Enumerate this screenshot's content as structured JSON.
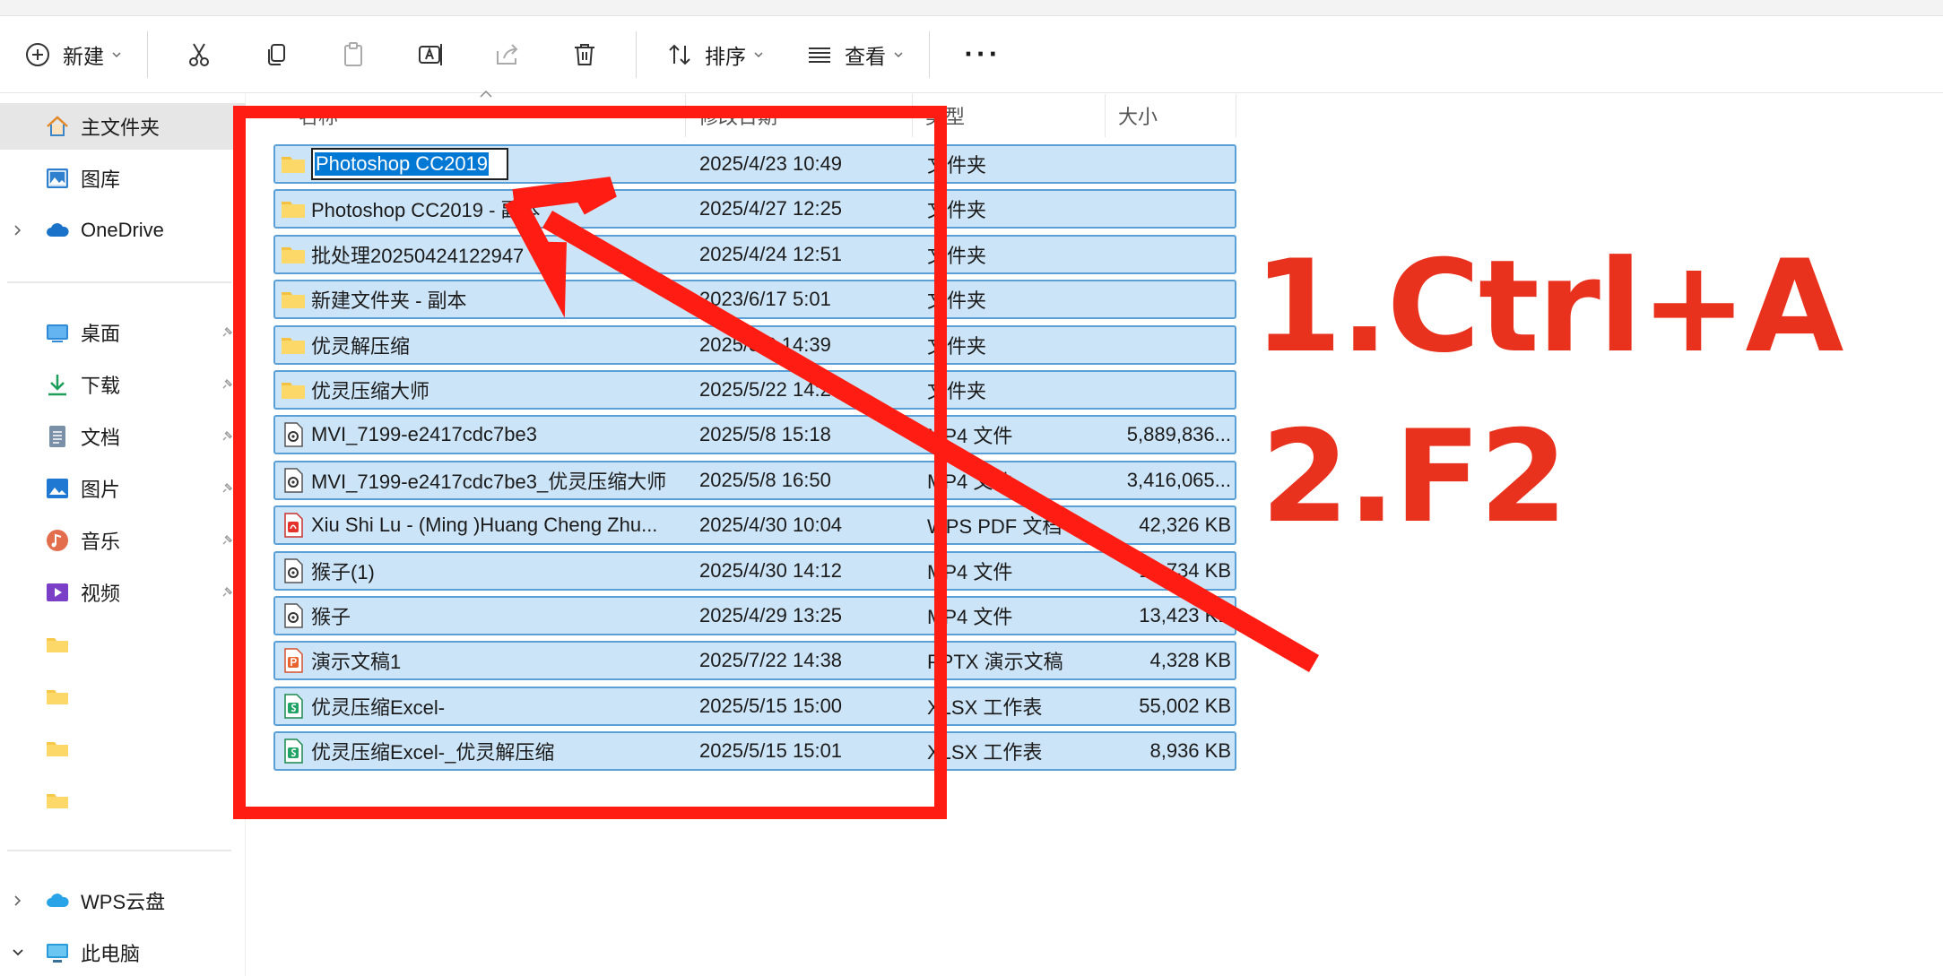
{
  "toolbar": {
    "new_label": "新建",
    "sort_label": "排序",
    "view_label": "查看",
    "more_label": "···"
  },
  "sidebar": {
    "items": [
      {
        "label": "主文件夹",
        "icon": "home-icon"
      },
      {
        "label": "图库",
        "icon": "gallery-icon"
      },
      {
        "label": "OneDrive",
        "icon": "cloud-icon"
      },
      {
        "label": "桌面",
        "icon": "desktop-icon"
      },
      {
        "label": "下载",
        "icon": "download-icon"
      },
      {
        "label": "文档",
        "icon": "document-icon"
      },
      {
        "label": "图片",
        "icon": "pictures-icon"
      },
      {
        "label": "音乐",
        "icon": "music-icon"
      },
      {
        "label": "视频",
        "icon": "video-icon"
      },
      {
        "label": "",
        "icon": "folder-icon"
      },
      {
        "label": "",
        "icon": "folder-icon"
      },
      {
        "label": "",
        "icon": "folder-icon"
      },
      {
        "label": "",
        "icon": "folder-icon"
      },
      {
        "label": "WPS云盘",
        "icon": "cloud-icon"
      },
      {
        "label": "此电脑",
        "icon": "computer-icon"
      }
    ]
  },
  "columns": {
    "name": "名称",
    "date": "修改日期",
    "type": "类型",
    "size": "大小"
  },
  "rename_value": "Photoshop CC2019",
  "files": [
    {
      "name": "Photoshop CC2019",
      "date": "2025/4/23 10:49",
      "type": "文件夹",
      "size": "",
      "icon": "folder-icon"
    },
    {
      "name": "Photoshop CC2019 - 副本",
      "date": "2025/4/27 12:25",
      "type": "文件夹",
      "size": "",
      "icon": "folder-icon"
    },
    {
      "name": "批处理20250424122947",
      "date": "2025/4/24 12:51",
      "type": "文件夹",
      "size": "",
      "icon": "folder-icon"
    },
    {
      "name": "新建文件夹 - 副本",
      "date": "2023/6/17 5:01",
      "type": "文件夹",
      "size": "",
      "icon": "folder-icon"
    },
    {
      "name": "优灵解压缩",
      "date": "2025/3/6 14:39",
      "type": "文件夹",
      "size": "",
      "icon": "folder-icon"
    },
    {
      "name": "优灵压缩大师",
      "date": "2025/5/22 14:24",
      "type": "文件夹",
      "size": "",
      "icon": "folder-icon"
    },
    {
      "name": "MVI_7199-e2417cdc7be3",
      "date": "2025/5/8 15:18",
      "type": "MP4 文件",
      "size": "5,889,836...",
      "icon": "video-file-icon"
    },
    {
      "name": "MVI_7199-e2417cdc7be3_优灵压缩大师",
      "date": "2025/5/8 16:50",
      "type": "MP4 文件",
      "size": "3,416,065...",
      "icon": "video-file-icon"
    },
    {
      "name": "Xiu Shi Lu - (Ming )Huang Cheng Zhu...",
      "date": "2025/4/30 10:04",
      "type": "WPS PDF 文档",
      "size": "42,326 KB",
      "icon": "pdf-file-icon"
    },
    {
      "name": "猴子(1)",
      "date": "2025/4/30 14:12",
      "type": "MP4 文件",
      "size": "13,734 KB",
      "icon": "video-file-icon"
    },
    {
      "name": "猴子",
      "date": "2025/4/29 13:25",
      "type": "MP4 文件",
      "size": "13,423 KB",
      "icon": "video-file-icon"
    },
    {
      "name": "演示文稿1",
      "date": "2025/7/22 14:38",
      "type": "PPTX 演示文稿",
      "size": "4,328 KB",
      "icon": "pptx-file-icon"
    },
    {
      "name": "优灵压缩Excel-",
      "date": "2025/5/15 15:00",
      "type": "XLSX 工作表",
      "size": "55,002 KB",
      "icon": "xlsx-file-icon"
    },
    {
      "name": "优灵压缩Excel-_优灵解压缩",
      "date": "2025/5/15 15:01",
      "type": "XLSX 工作表",
      "size": "8,936 KB",
      "icon": "xlsx-file-icon"
    }
  ],
  "annotations": {
    "step1": "1.Ctrl+A",
    "step2": "2.F2",
    "color": "#e8321e"
  }
}
